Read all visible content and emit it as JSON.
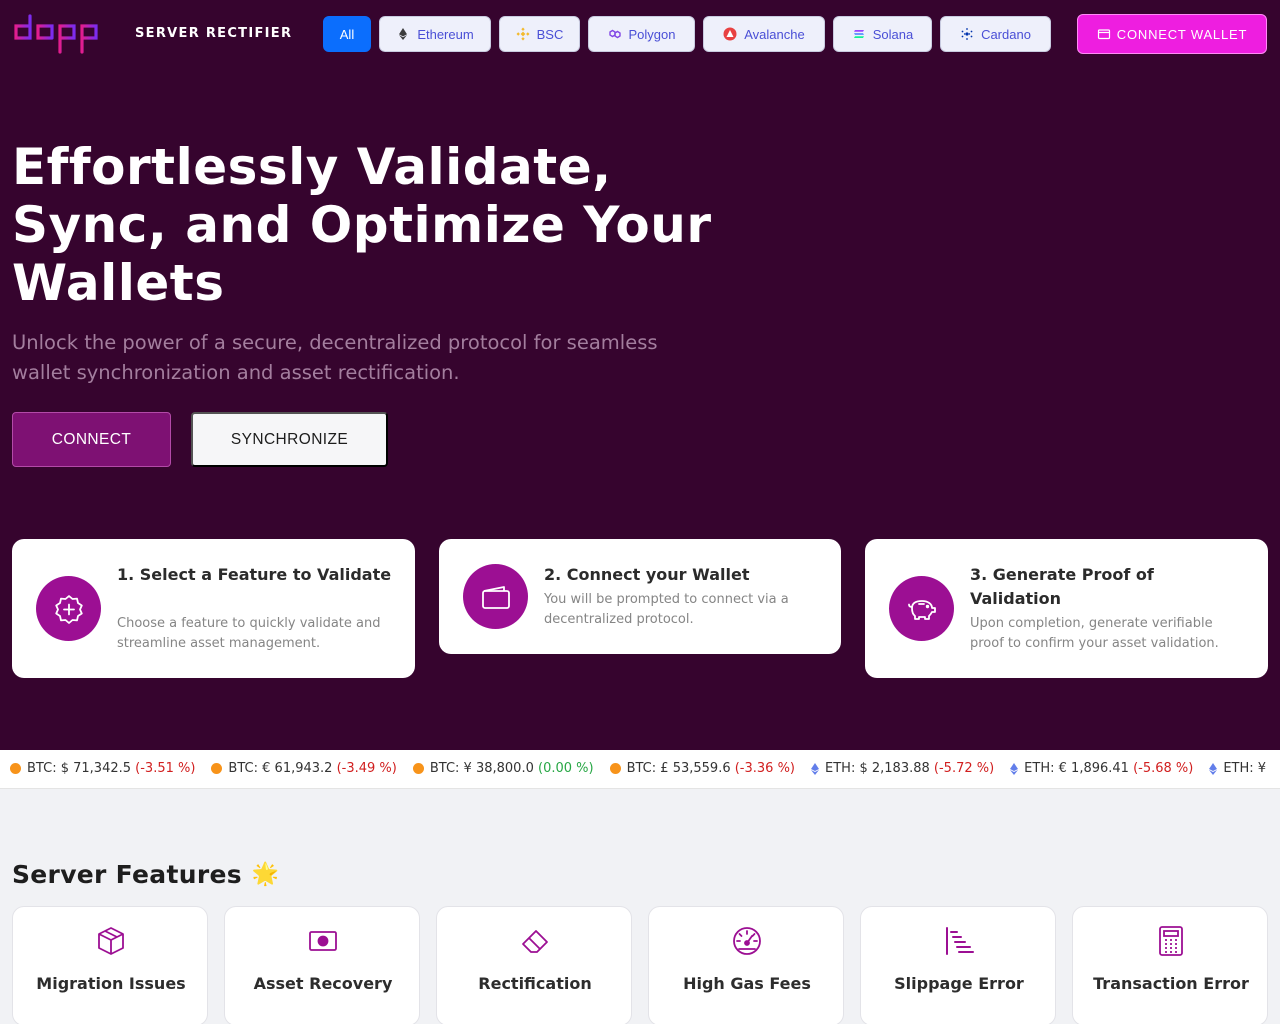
{
  "header": {
    "logo_text": "dapp",
    "brand": "SERVER RECTIFIER",
    "chains": [
      {
        "label": "All",
        "active": true
      },
      {
        "label": "Ethereum",
        "icon": "ethereum-icon"
      },
      {
        "label": "BSC",
        "icon": "bsc-icon"
      },
      {
        "label": "Polygon",
        "icon": "polygon-icon"
      },
      {
        "label": "Avalanche",
        "icon": "avalanche-icon"
      },
      {
        "label": "Solana",
        "icon": "solana-icon"
      },
      {
        "label": "Cardano",
        "icon": "cardano-icon"
      }
    ],
    "connect_wallet_label": "CONNECT WALLET"
  },
  "hero": {
    "title": "Effortlessly Validate, Sync, and Optimize Your Wallets",
    "subtitle": "Unlock the power of a secure, decentralized protocol for seamless wallet synchronization and asset rectification.",
    "connect_label": "CONNECT",
    "sync_label": "SYNCHRONIZE"
  },
  "steps": [
    {
      "title": "1. Select a Feature to Validate",
      "desc": "Choose a feature to quickly validate and streamline asset management.",
      "icon": "badge-plus-icon"
    },
    {
      "title": "2. Connect your Wallet",
      "desc": "You will be prompted to connect via a decentralized protocol.",
      "icon": "wallet-icon"
    },
    {
      "title": "3. Generate Proof of Validation",
      "desc": "Upon completion, generate verifiable proof to confirm your asset validation.",
      "icon": "piggy-bank-icon"
    }
  ],
  "ticker": [
    {
      "coin": "BTC",
      "currency": "$",
      "price": "71,342.5",
      "change": "(-3.51 %)",
      "dir": "neg"
    },
    {
      "coin": "BTC",
      "currency": "€",
      "price": "61,943.2",
      "change": "(-3.49 %)",
      "dir": "neg"
    },
    {
      "coin": "BTC",
      "currency": "¥",
      "price": "38,800.0",
      "change": "(0.00 %)",
      "dir": "zero"
    },
    {
      "coin": "BTC",
      "currency": "£",
      "price": "53,559.6",
      "change": "(-3.36 %)",
      "dir": "neg"
    },
    {
      "coin": "ETH",
      "currency": "$",
      "price": "2,183.88",
      "change": "(-5.72 %)",
      "dir": "neg"
    },
    {
      "coin": "ETH",
      "currency": "€",
      "price": "1,896.41",
      "change": "(-5.68 %)",
      "dir": "neg"
    },
    {
      "coin": "ETH",
      "currency": "¥",
      "price": "",
      "change": "",
      "dir": "neg"
    }
  ],
  "features": {
    "title": "Server Features",
    "emoji": "🌟",
    "items": [
      {
        "label": "Migration Issues",
        "icon": "box-icon"
      },
      {
        "label": "Asset Recovery",
        "icon": "camera-icon"
      },
      {
        "label": "Rectification",
        "icon": "eraser-icon"
      },
      {
        "label": "High Gas Fees",
        "icon": "gauge-icon"
      },
      {
        "label": "Slippage Error",
        "icon": "gantt-chart-icon"
      },
      {
        "label": "Transaction Error",
        "icon": "calculator-icon"
      }
    ]
  },
  "colors": {
    "hero_bg": "#36042e",
    "accent": "#9c0f93",
    "connect_wallet": "#ee1ee0",
    "active_chain": "#0b6efd",
    "negative": "#d11f1f",
    "neutral_change": "#28a745"
  }
}
